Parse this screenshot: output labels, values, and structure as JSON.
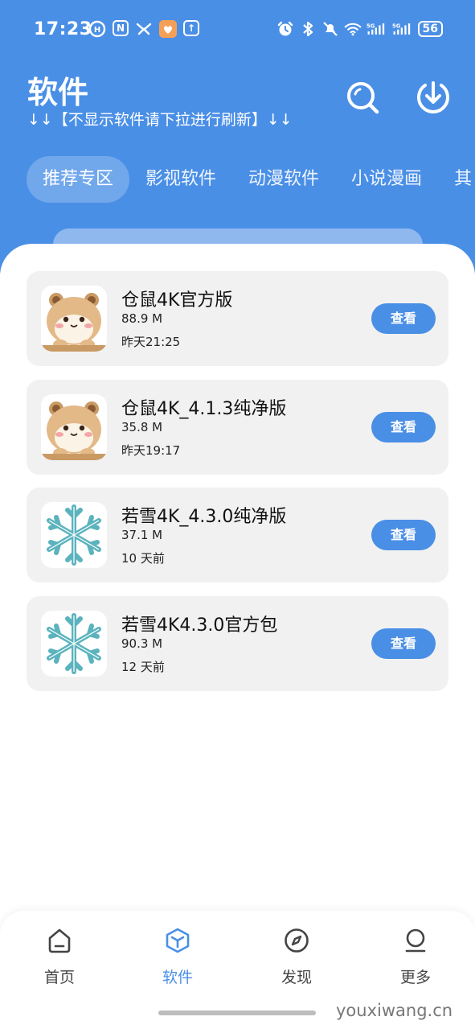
{
  "status_bar": {
    "time": "17:23",
    "battery": "56",
    "left_icons": [
      "hd-icon",
      "nfc-icon",
      "app-icon",
      "shield-icon",
      "upload-icon"
    ],
    "right_icons": [
      "alarm-icon",
      "bluetooth-icon",
      "mute-icon",
      "wifi-icon",
      "signal-5g-icon",
      "signal-5g-icon"
    ],
    "signal_label": "5G"
  },
  "header": {
    "title": "软件",
    "hint": "↓↓【不显示软件请下拉进行刷新】↓↓",
    "bg_color": "#4a8fe6"
  },
  "tabs": [
    {
      "label": "推荐专区",
      "active": true
    },
    {
      "label": "影视软件",
      "active": false
    },
    {
      "label": "动漫软件",
      "active": false
    },
    {
      "label": "小说漫画",
      "active": false
    },
    {
      "label": "其",
      "active": false
    }
  ],
  "apps": [
    {
      "name": "仓鼠4K官方版",
      "size": "88.9 M",
      "time": "昨天21:25",
      "icon": "hamster-icon",
      "button": "查看"
    },
    {
      "name": "仓鼠4K_4.1.3纯净版",
      "size": "35.8 M",
      "time": "昨天19:17",
      "icon": "hamster-icon",
      "button": "查看"
    },
    {
      "name": "若雪4K_4.3.0纯净版",
      "size": "37.1 M",
      "time": "10 天前",
      "icon": "snowflake-icon",
      "button": "查看"
    },
    {
      "name": "若雪4K4.3.0官方包",
      "size": "90.3 M",
      "time": "12 天前",
      "icon": "snowflake-icon",
      "button": "查看"
    }
  ],
  "bottom_nav": [
    {
      "label": "首页",
      "icon": "home-icon",
      "active": false
    },
    {
      "label": "软件",
      "icon": "box-icon",
      "active": true
    },
    {
      "label": "发现",
      "icon": "compass-icon",
      "active": false
    },
    {
      "label": "更多",
      "icon": "user-icon",
      "active": false
    }
  ],
  "watermark": "youxiwang.cn"
}
